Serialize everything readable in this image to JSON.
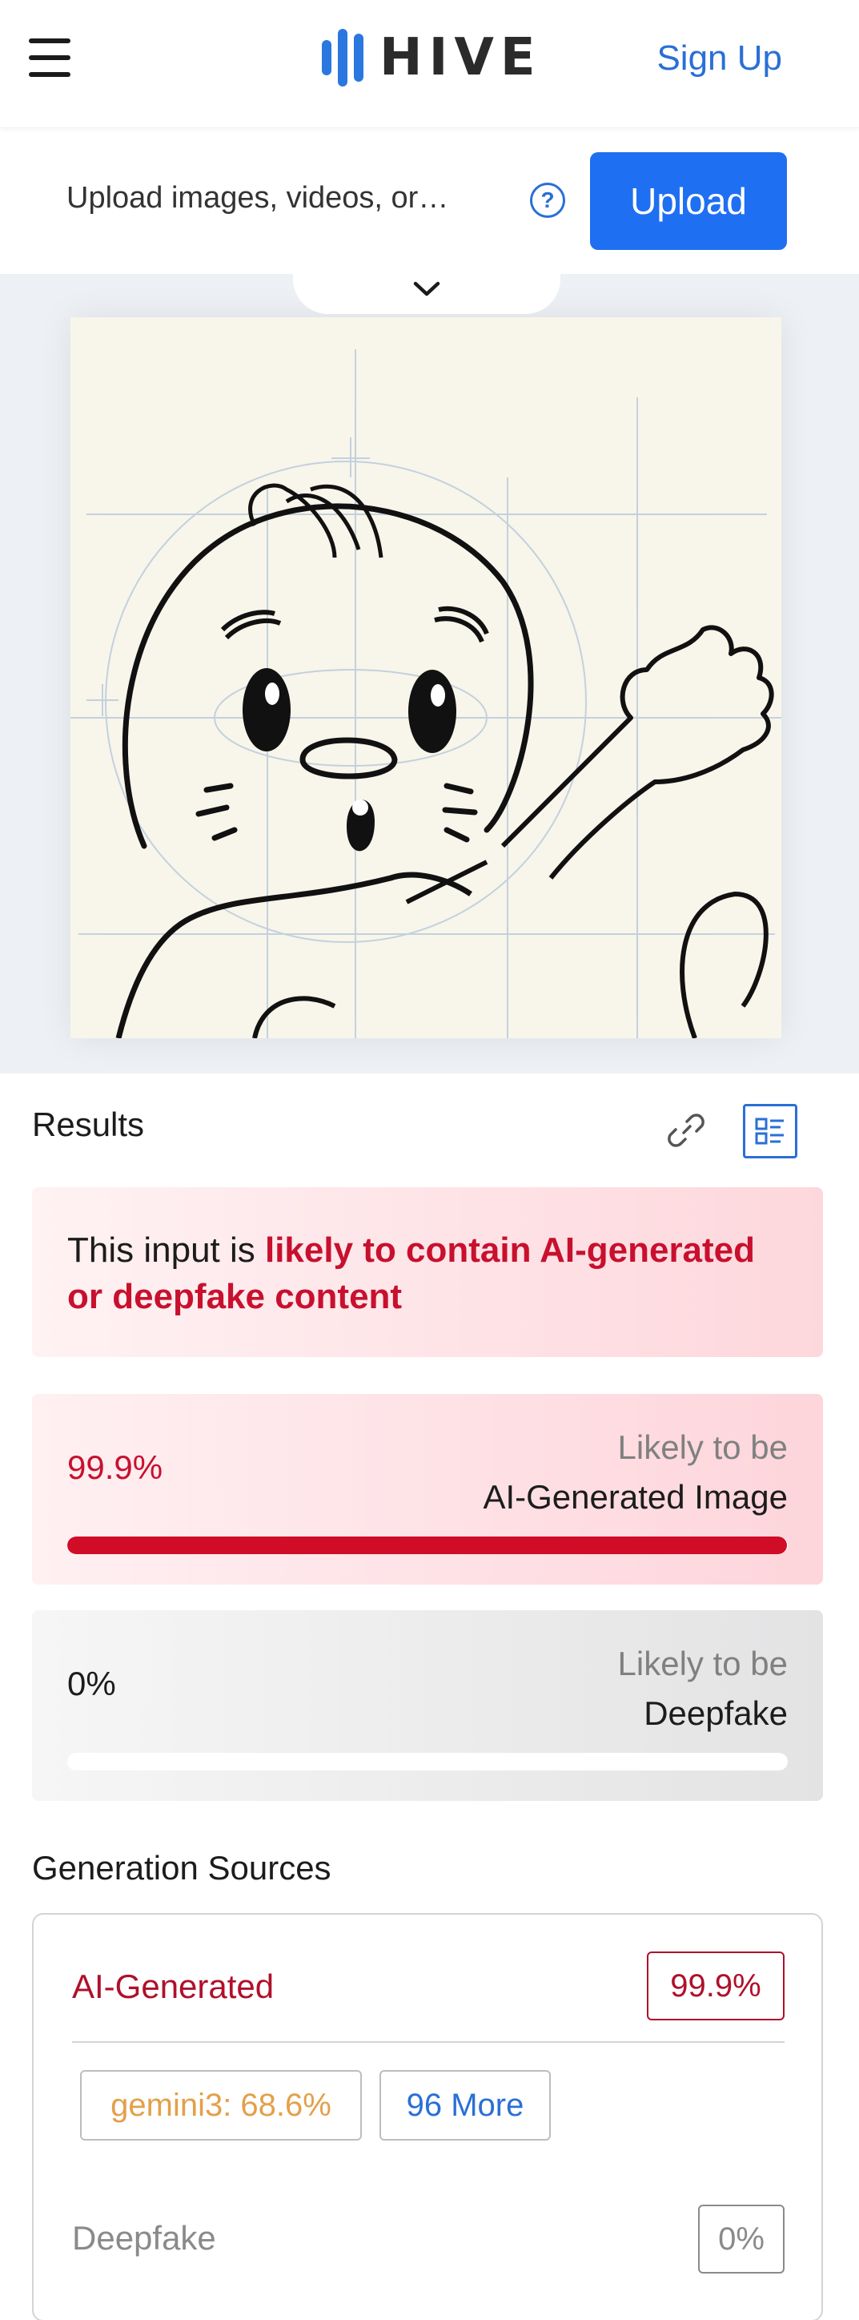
{
  "header": {
    "logo_text": "HIVE",
    "signup_label": "Sign Up"
  },
  "upload": {
    "placeholder": "Upload images, videos, or…",
    "help_glyph": "?",
    "button_label": "Upload"
  },
  "results": {
    "title": "Results",
    "verdict_prefix": "This input is ",
    "verdict_emphasis": "likely to contain AI-generated or deepfake content",
    "cards": [
      {
        "percent": "99.9%",
        "likely_label": "Likely to be",
        "class_label": "AI-Generated Image",
        "level": 0.999
      },
      {
        "percent": "0%",
        "likely_label": "Likely to be",
        "class_label": "Deepfake",
        "level": 0.0
      }
    ]
  },
  "generation_sources": {
    "title": "Generation Sources",
    "ai_label": "AI-Generated",
    "ai_value": "99.9%",
    "source_chip": "gemini3: 68.6%",
    "more_chip": "96 More",
    "deepfake_label": "Deepfake",
    "deepfake_value": "0%"
  },
  "icons": [
    "hamburger-icon",
    "hive-logo-icon",
    "help-icon",
    "chevron-down-icon",
    "link-icon",
    "list-view-icon"
  ],
  "colors": {
    "accent": "#1f6ff2",
    "danger": "#c8102e",
    "source_chip": "#e3a04a"
  }
}
